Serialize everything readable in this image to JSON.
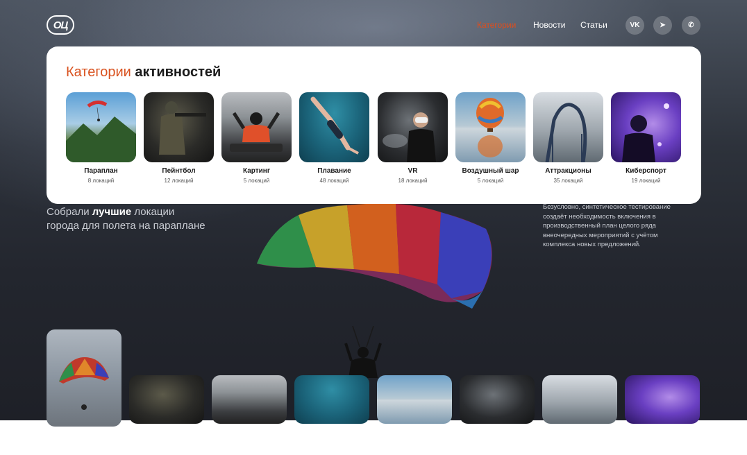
{
  "header": {
    "logo_text": "ОЦ",
    "nav": [
      {
        "label": "Категории",
        "active": true
      },
      {
        "label": "Новости",
        "active": false
      },
      {
        "label": "Статьи",
        "active": false
      }
    ],
    "social": [
      {
        "icon": "vk-icon",
        "glyph": "VK"
      },
      {
        "icon": "telegram-icon",
        "glyph": "➤"
      },
      {
        "icon": "whatsapp-icon",
        "glyph": "✆"
      }
    ]
  },
  "categories_panel": {
    "title_accent": "Категории",
    "title_bold": "активностей",
    "items": [
      {
        "name": "Параплан",
        "count": "8 локаций"
      },
      {
        "name": "Пейнтбол",
        "count": "12 локаций"
      },
      {
        "name": "Картинг",
        "count": "5 локаций"
      },
      {
        "name": "Плавание",
        "count": "48 локаций"
      },
      {
        "name": "VR",
        "count": "18 локаций"
      },
      {
        "name": "Воздушный шар",
        "count": "5 локаций"
      },
      {
        "name": "Аттракционы",
        "count": "35 локаций"
      },
      {
        "name": "Киберспорт",
        "count": "19 локаций"
      }
    ]
  },
  "hero": {
    "text_before": "Собрали ",
    "text_bold": "лучшие",
    "text_after": " локации города для полета на параплане",
    "description": "Безусловно, синтетическое тестирование создаёт необходимость включения в производственный план целого ряда внеочередных мероприятий с учётом комплекса новых предложений."
  },
  "colors": {
    "accent": "#e24d1a",
    "panel_bg": "#ffffff",
    "hero_bg": "#23262e"
  }
}
